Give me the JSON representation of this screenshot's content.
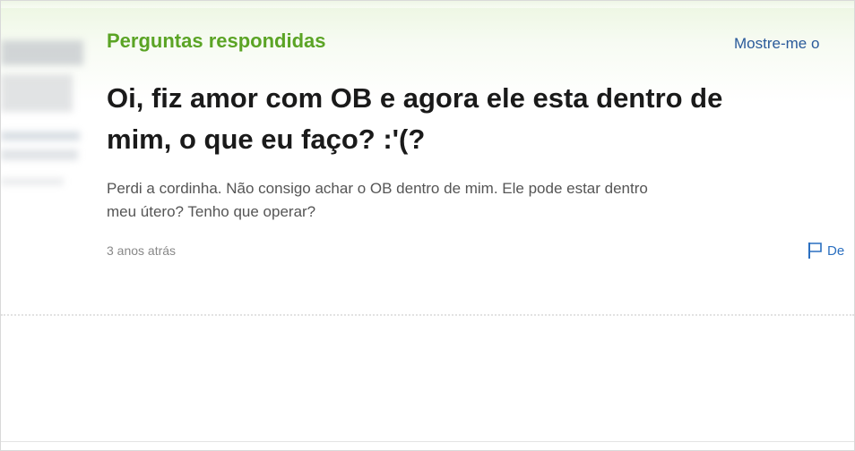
{
  "section": {
    "title": "Perguntas respondidas",
    "show_more": "Mostre-me o"
  },
  "question": {
    "title_line1": "Oi, fiz amor com OB e agora ele esta dentro de",
    "title_line2": "mim, o que eu faço? :'(?",
    "body_line1": "Perdi a cordinha. Não consigo achar o OB dentro de mim. Ele pode estar dentro",
    "body_line2": "meu útero? Tenho que operar?",
    "timestamp": "3 anos atrás",
    "report_label": "De"
  },
  "icons": {
    "report": "flag-icon"
  },
  "colors": {
    "section_title": "#5ba425",
    "link": "#2a5a9a",
    "question_title": "#1a1a1a",
    "body_text": "#555555"
  }
}
